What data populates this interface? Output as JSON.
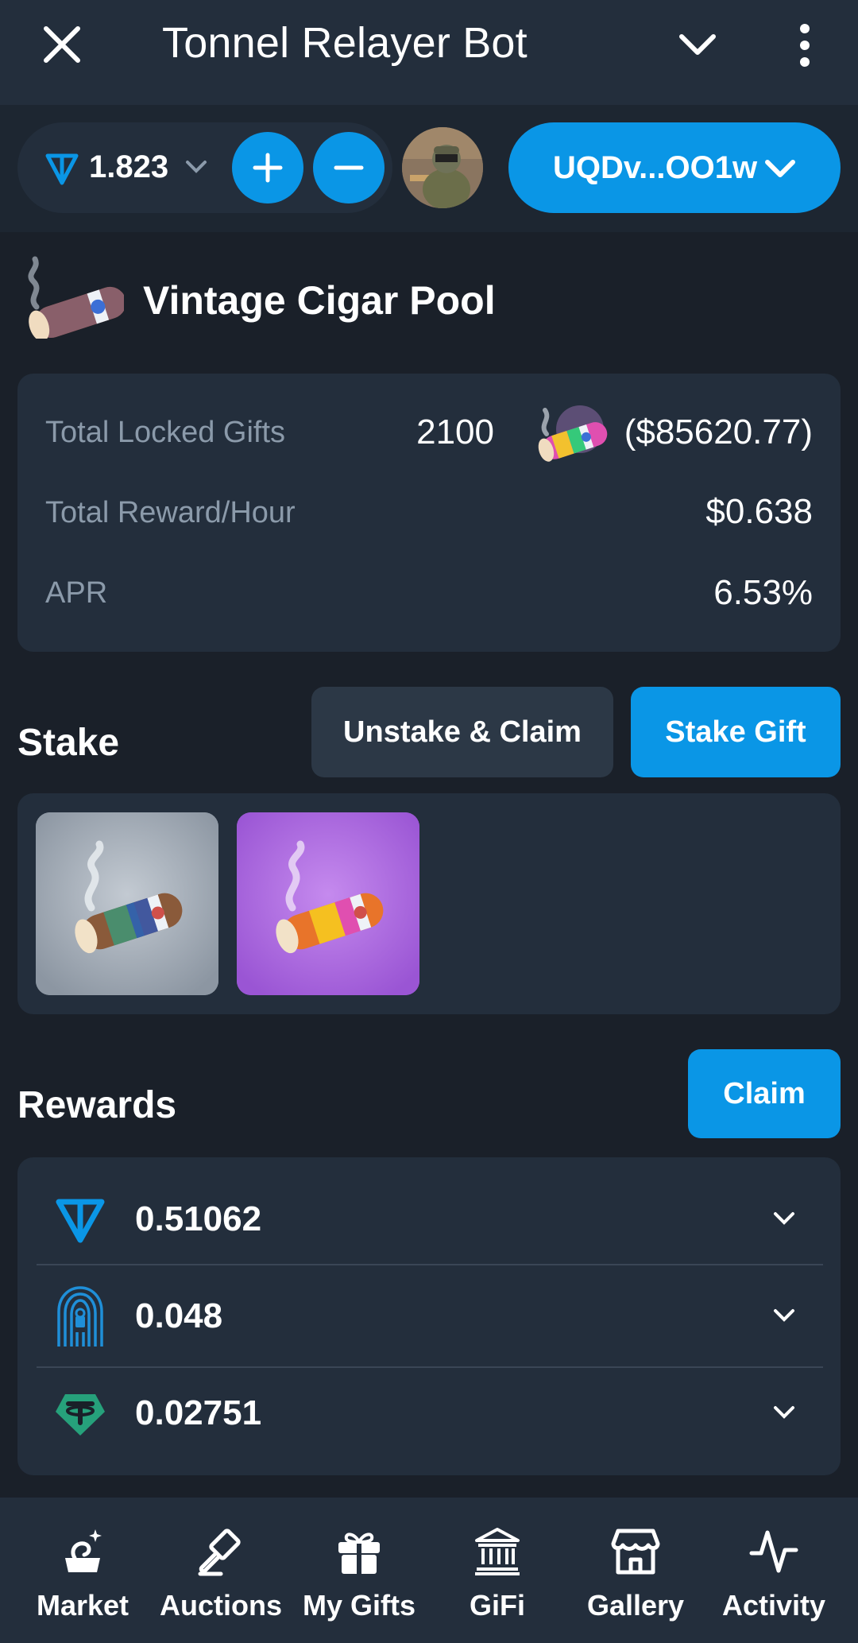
{
  "app": {
    "title": "Tonnel Relayer Bot"
  },
  "wallet": {
    "balance": "1.823",
    "address": "UQDv...OO1w"
  },
  "pool": {
    "title": "Vintage Cigar Pool"
  },
  "stats": {
    "locked_label": "Total Locked Gifts",
    "locked_count": "2100",
    "locked_usd": "($85620.77)",
    "reward_label": "Total Reward/Hour",
    "reward_value": "$0.638",
    "apr_label": "APR",
    "apr_value": "6.53%"
  },
  "stake": {
    "title": "Stake",
    "unstake_label": "Unstake & Claim",
    "stake_label": "Stake Gift"
  },
  "rewards": {
    "title": "Rewards",
    "claim_label": "Claim",
    "items": [
      {
        "token": "ton-icon",
        "value": "0.51062"
      },
      {
        "token": "fingerprint-lock-icon",
        "value": "0.048"
      },
      {
        "token": "usdt-icon",
        "value": "0.02751"
      }
    ]
  },
  "nav": {
    "items": [
      {
        "label": "Market",
        "icon": "market-icon"
      },
      {
        "label": "Auctions",
        "icon": "gavel-icon"
      },
      {
        "label": "My Gifts",
        "icon": "gift-icon"
      },
      {
        "label": "GiFi",
        "icon": "bank-icon"
      },
      {
        "label": "Gallery",
        "icon": "store-icon"
      },
      {
        "label": "Activity",
        "icon": "activity-icon"
      }
    ]
  },
  "colors": {
    "accent": "#0a96e6",
    "background": "#1a2029",
    "card": "#232e3c",
    "muted_text": "#8b9aaa",
    "usdt": "#26a17b"
  }
}
